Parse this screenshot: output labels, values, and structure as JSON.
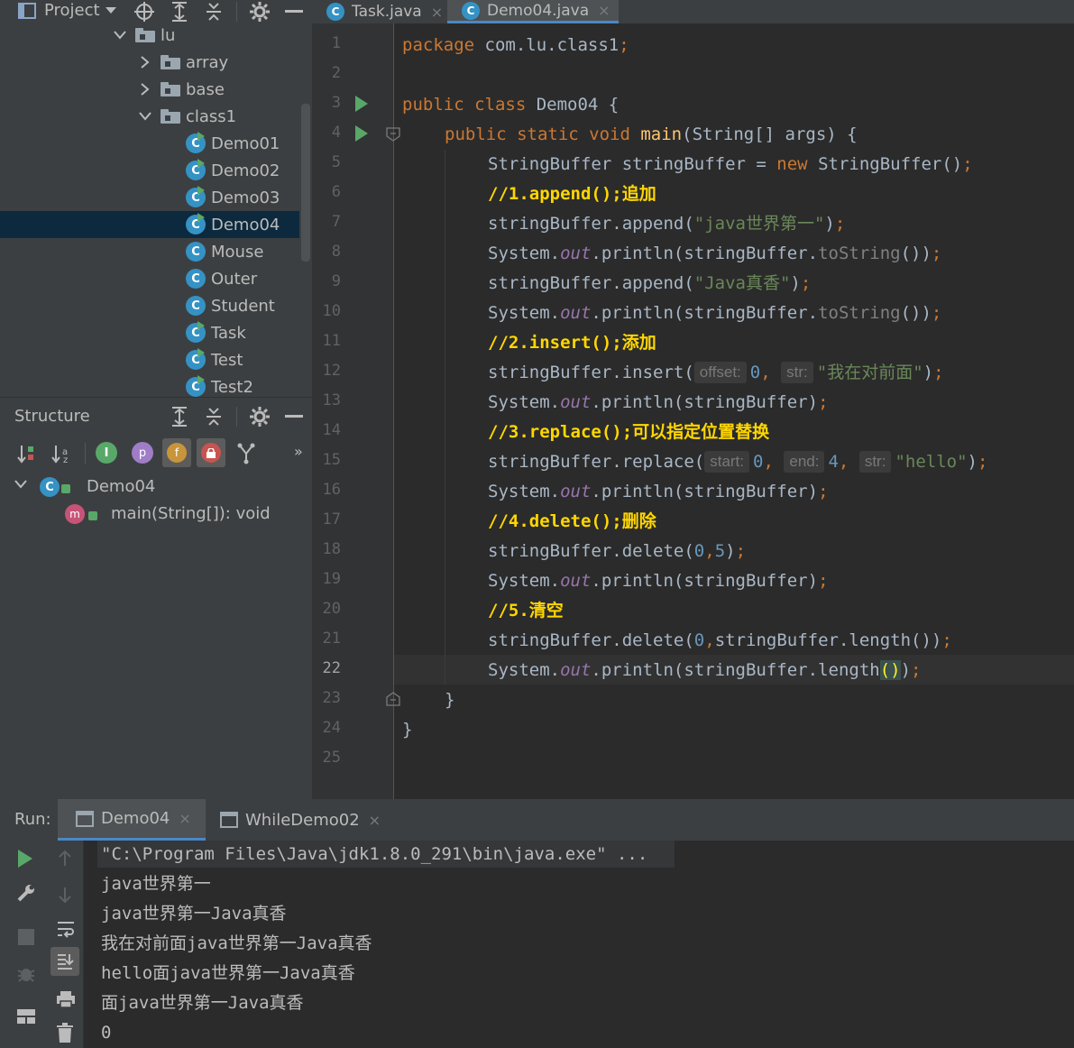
{
  "project_panel": {
    "title": "Project",
    "tree": [
      {
        "label": "lu",
        "kind": "folder",
        "expanded": true
      },
      {
        "label": "array",
        "kind": "folder",
        "expanded": false
      },
      {
        "label": "base",
        "kind": "folder",
        "expanded": false
      },
      {
        "label": "class1",
        "kind": "folder",
        "expanded": true
      },
      {
        "label": "Demo01",
        "kind": "class-runnable"
      },
      {
        "label": "Demo02",
        "kind": "class-runnable"
      },
      {
        "label": "Demo03",
        "kind": "class-runnable"
      },
      {
        "label": "Demo04",
        "kind": "class-runnable",
        "selected": true
      },
      {
        "label": "Mouse",
        "kind": "class"
      },
      {
        "label": "Outer",
        "kind": "class"
      },
      {
        "label": "Student",
        "kind": "class"
      },
      {
        "label": "Task",
        "kind": "class-runnable"
      },
      {
        "label": "Test",
        "kind": "class-runnable"
      },
      {
        "label": "Test2",
        "kind": "class-runnable"
      }
    ]
  },
  "structure_panel": {
    "title": "Structure",
    "filter_badges": [
      "f",
      "p"
    ],
    "more": "»",
    "class_name": "Demo04",
    "method": "main(String[]): void",
    "method_badge": "m"
  },
  "editor": {
    "tabs": [
      {
        "label": "Task.java",
        "active": false
      },
      {
        "label": "Demo04.java",
        "active": true
      }
    ],
    "line_numbers": [
      "1",
      "2",
      "3",
      "4",
      "5",
      "6",
      "7",
      "8",
      "9",
      "10",
      "11",
      "12",
      "13",
      "14",
      "15",
      "16",
      "17",
      "18",
      "19",
      "20",
      "21",
      "22",
      "23",
      "24",
      "25"
    ],
    "code": {
      "l1_kw": "package",
      "l1_rest": " com.lu.class1",
      "semi": ";",
      "l3_kw": "public class",
      "l3_rest": " Demo04 {",
      "l4_kw": "public static void",
      "l4_fn": "main",
      "l4_rest": "(String[] args) {",
      "l5_a": "StringBuffer stringBuffer = ",
      "l5_kw": "new",
      "l5_b": " StringBuffer()",
      "l6": "//1.append();追加",
      "l7_a": "stringBuffer.append(",
      "l7_str": "\"java世界第一\"",
      "l7_b": ")",
      "sys": "System.",
      "out": "out",
      "println_ts": ".println(stringBuffer.",
      "tostring": "toString",
      "ts_close": "())",
      "l9_a": "stringBuffer.append(",
      "l9_str": "\"Java真香\"",
      "l9_b": ")",
      "l11": "//2.insert();添加",
      "l12_a": "stringBuffer.insert(",
      "l12_hint1": "offset:",
      "l12_num": "0",
      "comma": ",",
      "l12_hint2": "str:",
      "l12_str": "\"我在对前面\"",
      "l12_b": ")",
      "println_sb": ".println(stringBuffer)",
      "l14": "//3.replace();可以指定位置替换",
      "l15_a": "stringBuffer.replace(",
      "l15_hint1": "start:",
      "l15_n1": "0",
      "l15_hint2": "end:",
      "l15_n2": "4",
      "l15_hint3": "str:",
      "l15_str": "\"hello\"",
      "l15_b": ")",
      "l17": "//4.delete();删除",
      "l18_a": "stringBuffer.delete(",
      "l18_n1": "0",
      "l18_n2": "5",
      "l18_b": ")",
      "l20": "//5.清空",
      "l21_a": "stringBuffer.delete(",
      "l21_n1": "0",
      "l21_b": "stringBuffer.length())",
      "l22_b": ".println(stringBuffer.length",
      "l22_paren": "()",
      "l22_c": ")",
      "l23": "}",
      "l24": "}"
    }
  },
  "run_panel": {
    "label": "Run:",
    "tabs": [
      {
        "label": "Demo04",
        "active": true
      },
      {
        "label": "WhileDemo02",
        "active": false
      }
    ],
    "output": [
      "\"C:\\Program Files\\Java\\jdk1.8.0_291\\bin\\java.exe\" ...",
      "java世界第一",
      "java世界第一Java真香",
      "我在对前面java世界第一Java真香",
      "hello面java世界第一Java真香",
      "面java世界第一Java真香",
      "0"
    ]
  },
  "colors": {
    "keyword": "#cc7832",
    "string": "#6a8759",
    "number": "#6897bb",
    "comment": "#ffd700",
    "function": "#ffc66d",
    "field": "#9876aa",
    "selection": "#0d293e",
    "class_icon": "#3592c4",
    "run_green": "#59a869"
  }
}
